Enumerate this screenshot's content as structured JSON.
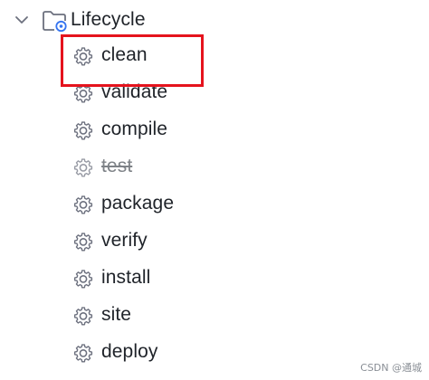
{
  "tree": {
    "root": {
      "label": "Lifecycle",
      "icon": "maven-folder-icon",
      "expanded": true
    },
    "items": [
      {
        "label": "clean",
        "icon": "gear-icon",
        "disabled": false
      },
      {
        "label": "validate",
        "icon": "gear-icon",
        "disabled": false
      },
      {
        "label": "compile",
        "icon": "gear-icon",
        "disabled": false
      },
      {
        "label": "test",
        "icon": "gear-icon",
        "disabled": true
      },
      {
        "label": "package",
        "icon": "gear-icon",
        "disabled": false
      },
      {
        "label": "verify",
        "icon": "gear-icon",
        "disabled": false
      },
      {
        "label": "install",
        "icon": "gear-icon",
        "disabled": false
      },
      {
        "label": "site",
        "icon": "gear-icon",
        "disabled": false
      },
      {
        "label": "deploy",
        "icon": "gear-icon",
        "disabled": false
      }
    ]
  },
  "annotation": {
    "highlight_color": "#e5131d",
    "highlighted_item": "clean"
  },
  "watermark": "CSDN @通城",
  "colors": {
    "text": "#1f2329",
    "disabled_text": "#7e8287",
    "icon": "#6c707e",
    "folder_badge": "#3574f0"
  }
}
